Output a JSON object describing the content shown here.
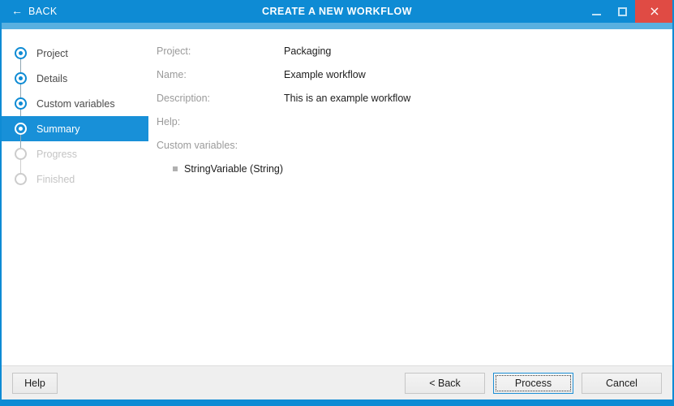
{
  "titlebar": {
    "back_label": "BACK",
    "back_icon": "arrow-left-icon",
    "title": "CREATE A NEW WORKFLOW",
    "minimize_icon": "minimize-icon",
    "maximize_icon": "maximize-icon",
    "close_icon": "close-icon",
    "close_glyph": "×",
    "arrow_glyph": "←",
    "accent_color": "#0e8bd4",
    "close_color": "#e04b44"
  },
  "sidebar": {
    "steps": [
      {
        "label": "Project",
        "state": "complete"
      },
      {
        "label": "Details",
        "state": "complete"
      },
      {
        "label": "Custom variables",
        "state": "complete"
      },
      {
        "label": "Summary",
        "state": "active"
      },
      {
        "label": "Progress",
        "state": "disabled"
      },
      {
        "label": "Finished",
        "state": "disabled"
      }
    ],
    "active_color": "#1890d8"
  },
  "content": {
    "fields": [
      {
        "label": "Project:",
        "value": "Packaging"
      },
      {
        "label": "Name:",
        "value": "Example workflow"
      },
      {
        "label": "Description:",
        "value": "This is an example workflow"
      },
      {
        "label": "Help:",
        "value": ""
      },
      {
        "label": "Custom variables:",
        "value": ""
      }
    ],
    "custom_variables": [
      {
        "text": "StringVariable (String)"
      }
    ]
  },
  "footer": {
    "help_label": "Help",
    "back_label": "< Back",
    "process_label": "Process",
    "cancel_label": "Cancel",
    "focused_button": "Process"
  }
}
